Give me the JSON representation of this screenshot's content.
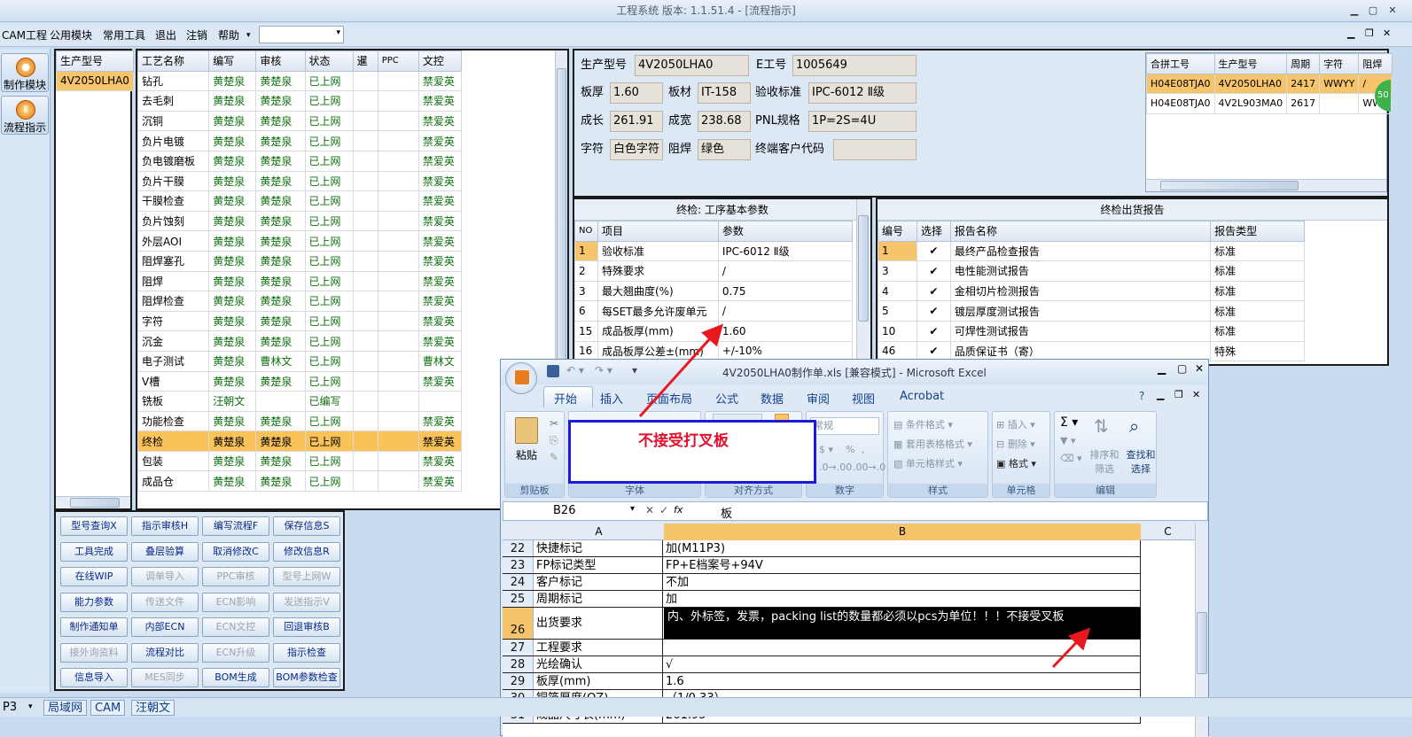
{
  "window": {
    "title": "工程系统  版本: 1.1.51.4 - [流程指示]"
  },
  "menu": {
    "items": [
      "CAM工程",
      "公用模块",
      "常用工具",
      "退出",
      "注销",
      "帮助"
    ]
  },
  "nav": {
    "make": "制作模块",
    "flow": "流程指示"
  },
  "model_list": {
    "header": "生产型号",
    "items": [
      "4V2050LHA0"
    ]
  },
  "process": {
    "headers": [
      "工艺名称",
      "编写",
      "审核",
      "状态",
      "暹",
      "PPC",
      "文控"
    ],
    "rows": [
      [
        "钻孔",
        "黄楚泉",
        "黄楚泉",
        "已上网",
        "",
        "",
        "禁爱英"
      ],
      [
        "去毛刺",
        "黄楚泉",
        "黄楚泉",
        "已上网",
        "",
        "",
        "禁爱英"
      ],
      [
        "沉铜",
        "黄楚泉",
        "黄楚泉",
        "已上网",
        "",
        "",
        "禁爱英"
      ],
      [
        "负片电镀",
        "黄楚泉",
        "黄楚泉",
        "已上网",
        "",
        "",
        "禁爱英"
      ],
      [
        "负电镀磨板",
        "黄楚泉",
        "黄楚泉",
        "已上网",
        "",
        "",
        "禁爱英"
      ],
      [
        "负片干膜",
        "黄楚泉",
        "黄楚泉",
        "已上网",
        "",
        "",
        "禁爱英"
      ],
      [
        "干膜检查",
        "黄楚泉",
        "黄楚泉",
        "已上网",
        "",
        "",
        "禁爱英"
      ],
      [
        "负片蚀刻",
        "黄楚泉",
        "黄楚泉",
        "已上网",
        "",
        "",
        "禁爱英"
      ],
      [
        "外层AOI",
        "黄楚泉",
        "黄楚泉",
        "已上网",
        "",
        "",
        "禁爱英"
      ],
      [
        "阻焊塞孔",
        "黄楚泉",
        "黄楚泉",
        "已上网",
        "",
        "",
        "禁爱英"
      ],
      [
        "阻焊",
        "黄楚泉",
        "黄楚泉",
        "已上网",
        "",
        "",
        "禁爱英"
      ],
      [
        "阻焊检查",
        "黄楚泉",
        "黄楚泉",
        "已上网",
        "",
        "",
        "禁爱英"
      ],
      [
        "字符",
        "黄楚泉",
        "黄楚泉",
        "已上网",
        "",
        "",
        "禁爱英"
      ],
      [
        "沉金",
        "黄楚泉",
        "黄楚泉",
        "已上网",
        "",
        "",
        "禁爱英"
      ],
      [
        "电子测试",
        "黄楚泉",
        "曹林文",
        "已上网",
        "",
        "",
        "曹林文"
      ],
      [
        "V槽",
        "黄楚泉",
        "黄楚泉",
        "已上网",
        "",
        "",
        "禁爱英"
      ],
      [
        "铣板",
        "汪朝文",
        "",
        "已编写",
        "",
        "",
        ""
      ],
      [
        "功能检查",
        "黄楚泉",
        "黄楚泉",
        "已上网",
        "",
        "",
        "禁爱英"
      ],
      [
        "终检",
        "黄楚泉",
        "黄楚泉",
        "已上网",
        "",
        "",
        "禁爱英"
      ],
      [
        "包装",
        "黄楚泉",
        "黄楚泉",
        "已上网",
        "",
        "",
        "禁爱英"
      ],
      [
        "成品仓",
        "黄楚泉",
        "黄楚泉",
        "已上网",
        "",
        "",
        "禁爱英"
      ]
    ]
  },
  "buttons": [
    [
      "型号查询X",
      "指示审核H",
      "编写流程F",
      "保存信息S"
    ],
    [
      "工具完成",
      "叠层验算",
      "取消修改C",
      "修改信息R"
    ],
    [
      "在线WIP",
      "调单导入",
      "PPC审核",
      "型号上网W"
    ],
    [
      "能力参数",
      "传送文件",
      "ECN影响",
      "发送指示V"
    ],
    [
      "制作通知单",
      "内部ECN",
      "ECN文控",
      "回退审核B"
    ],
    [
      "接外询资料",
      "流程对比",
      "ECN升级",
      "指示检查"
    ],
    [
      "信息导入",
      "MES同步",
      "BOM生成",
      "BOM参数检查"
    ]
  ],
  "info": {
    "model_label": "生产型号",
    "model": "4V2050LHA0",
    "eno_label": "E工号",
    "eno": "1005649",
    "thick_label": "板厚",
    "thick": "1.60",
    "mat_label": "板材",
    "mat": "IT-158",
    "std_label": "验收标准",
    "std": "IPC-6012 Ⅱ级",
    "len_label": "成长",
    "len": "261.91",
    "wid_label": "成宽",
    "wid": "238.68",
    "pnl_label": "PNL规格",
    "pnl": "1P=2S=4U",
    "char_label": "字符",
    "char": "白色字符",
    "sm_label": "阻焊",
    "sm": "绿色",
    "cust_label": "终端客户代码",
    "cust": ""
  },
  "combine": {
    "headers": [
      "合拼工号",
      "生产型号",
      "周期",
      "字符",
      "阻焊"
    ],
    "rows": [
      [
        "H04E08TJA0",
        "4V2050LHA0",
        "2417",
        "WWYY",
        "/"
      ],
      [
        "H04E08TJA0",
        "4V2L903MA0",
        "2617",
        "",
        "WWY"
      ]
    ],
    "badge": "50"
  },
  "params": {
    "title": "终检: 工序基本参数",
    "headers": [
      "NO",
      "项目",
      "参数"
    ],
    "rows": [
      [
        "1",
        "验收标准",
        "IPC-6012 Ⅱ级"
      ],
      [
        "2",
        "特殊要求",
        "/"
      ],
      [
        "3",
        "最大翘曲度(%)",
        "0.75"
      ],
      [
        "6",
        "每SET最多允许废单元",
        "/"
      ],
      [
        "15",
        "成品板厚(mm)",
        "1.60"
      ],
      [
        "16",
        "成品板厚公差±(mm)",
        "+/-10%"
      ]
    ]
  },
  "report": {
    "title": "终检出货报告",
    "headers": [
      "编号",
      "选择",
      "报告名称",
      "报告类型"
    ],
    "rows": [
      [
        "1",
        "✔",
        "最终产品检查报告",
        "标准"
      ],
      [
        "3",
        "✔",
        "电性能测试报告",
        "标准"
      ],
      [
        "4",
        "✔",
        "金相切片检测报告",
        "标准"
      ],
      [
        "5",
        "✔",
        "镀层厚度测试报告",
        "标准"
      ],
      [
        "10",
        "✔",
        "可焊性测试报告",
        "标准"
      ],
      [
        "46",
        "✔",
        "品质保证书（寄）",
        "特殊"
      ]
    ]
  },
  "excel": {
    "title": "4V2050LHA0制作单.xls  [兼容模式] - Microsoft Excel",
    "tabs": [
      "开始",
      "插入",
      "页面布局",
      "公式",
      "数据",
      "审阅",
      "视图",
      "Acrobat"
    ],
    "groups": [
      "剪贴板",
      "字体",
      "对齐方式",
      "数字",
      "样式",
      "单元格",
      "编辑"
    ],
    "paste": "粘贴",
    "number_fmt": "常规",
    "style_btns": [
      "条件格式",
      "套用表格格式",
      "单元格样式"
    ],
    "cell_btns": [
      "插入",
      "删除",
      "格式"
    ],
    "edit_btns": [
      "排序和筛选",
      "查找和选择"
    ],
    "namebox": "B26",
    "formula": "板",
    "cols": [
      "A",
      "B",
      "C"
    ],
    "rows": [
      [
        "22",
        "快捷标记",
        "加(M11P3)"
      ],
      [
        "23",
        "FP标记类型",
        "FP+E档案号+94V"
      ],
      [
        "24",
        "客户标记",
        "不加"
      ],
      [
        "25",
        "周期标记",
        "加"
      ],
      [
        "26",
        "出货要求",
        "内、外标签，发票，packing list的数量都必须以pcs为单位！！！不接受叉板"
      ],
      [
        "27",
        "工程要求",
        ""
      ],
      [
        "28",
        "光绘确认",
        "√"
      ],
      [
        "29",
        "板厚(mm)",
        "1.6"
      ],
      [
        "30",
        "铜箔厚度(OZ)",
        "（1/0.33）"
      ],
      [
        "31",
        "成品尺寸长(mm)",
        "261.95"
      ]
    ]
  },
  "annotation": {
    "text": "不接受打叉板"
  },
  "status": {
    "combo": "P3",
    "tabs": [
      "局域网",
      "CAM",
      "汪朝文"
    ]
  }
}
